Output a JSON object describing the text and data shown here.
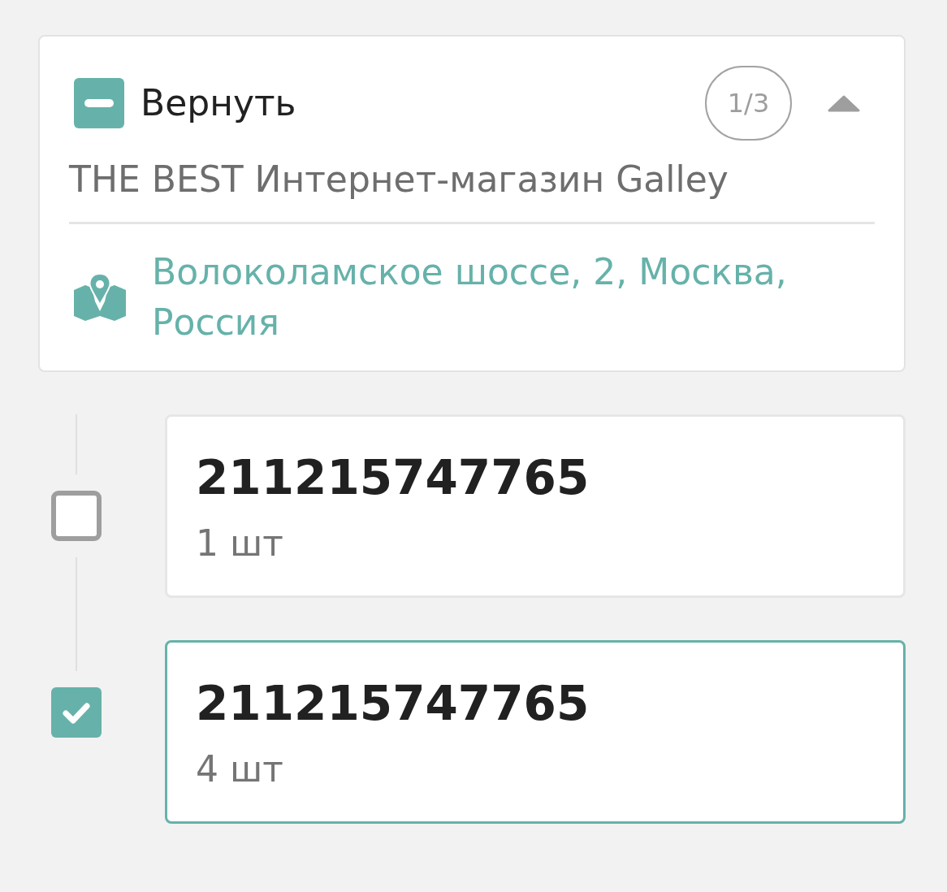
{
  "group": {
    "indeterminate": true,
    "title": "Вернуть",
    "counter": "1/3",
    "expanded": true,
    "subtitle": "THE BEST Интернет-магазин Galley",
    "address": "Волоколамское шоссе, 2, Москва, Россия"
  },
  "items": [
    {
      "number": "211215747765",
      "quantity": "1 шт",
      "checked": false
    },
    {
      "number": "211215747765",
      "quantity": "4 шт",
      "checked": true
    }
  ]
}
